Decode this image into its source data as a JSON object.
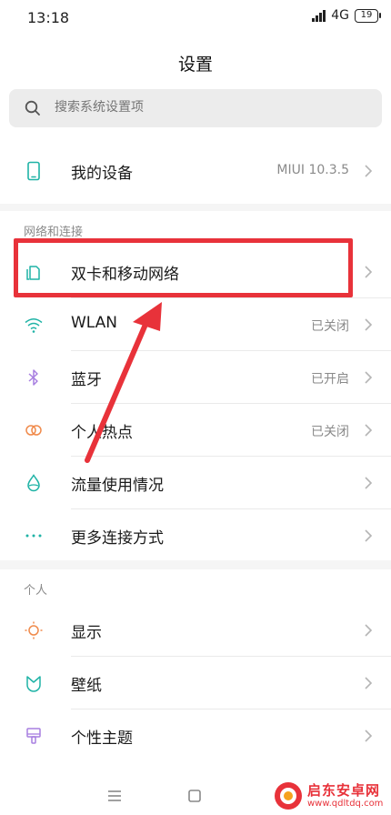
{
  "status_bar": {
    "time": "13:18",
    "network": "4G",
    "battery": "19"
  },
  "header": {
    "title": "设置"
  },
  "search": {
    "placeholder": "搜索系统设置项"
  },
  "device": {
    "label": "我的设备",
    "value": "MIUI 10.3.5"
  },
  "network_section": {
    "header": "网络和连接",
    "items": [
      {
        "label": "双卡和移动网络",
        "value": "",
        "icon": "sim-card-icon"
      },
      {
        "label": "WLAN",
        "value": "已关闭",
        "icon": "wifi-icon"
      },
      {
        "label": "蓝牙",
        "value": "已开启",
        "icon": "bluetooth-icon"
      },
      {
        "label": "个人热点",
        "value": "已关闭",
        "icon": "hotspot-icon"
      },
      {
        "label": "流量使用情况",
        "value": "",
        "icon": "data-usage-icon"
      },
      {
        "label": "更多连接方式",
        "value": "",
        "icon": "more-connections-icon"
      }
    ]
  },
  "personal_section": {
    "header": "个人",
    "items": [
      {
        "label": "显示",
        "value": "",
        "icon": "display-icon"
      },
      {
        "label": "壁纸",
        "value": "",
        "icon": "wallpaper-icon"
      },
      {
        "label": "个性主题",
        "value": "",
        "icon": "theme-icon"
      }
    ]
  },
  "watermark": {
    "title": "启东安卓网",
    "url": "www.qdltdq.com"
  },
  "colors": {
    "highlight": "#e8323a",
    "accent_teal": "#1fb3a6",
    "bluetooth": "#a77ee0",
    "hotspot": "#f08a4b"
  }
}
